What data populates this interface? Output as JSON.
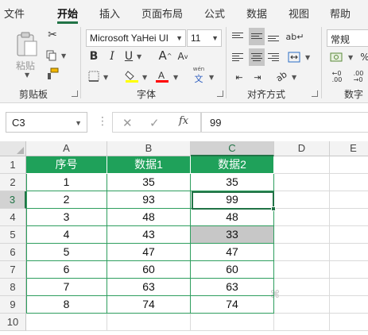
{
  "tabs": [
    "文件",
    "开始",
    "插入",
    "页面布局",
    "公式",
    "数据",
    "视图",
    "帮助"
  ],
  "active_tab": "开始",
  "ribbon": {
    "clipboard": {
      "paste_label": "粘贴",
      "group_label": "剪贴板"
    },
    "font": {
      "font_name": "Microsoft YaHei UI",
      "font_size": "11",
      "group_label": "字体",
      "bold": "B",
      "italic": "I",
      "underline": "U",
      "grow": "A",
      "shrink": "A",
      "phonetic": "文",
      "phonetic_top": "wén",
      "highlight_color": "#ffff00",
      "font_color": "#ff0000"
    },
    "alignment": {
      "group_label": "对齐方式"
    },
    "number": {
      "format": "常规",
      "group_label": "数字"
    }
  },
  "formula_bar": {
    "name_box": "C3",
    "fx": "fx",
    "value": "99",
    "cancel": "✕",
    "enter": "✓"
  },
  "sheet": {
    "columns": [
      "A",
      "B",
      "C",
      "D",
      "E"
    ],
    "active_column": "C",
    "rows": [
      "1",
      "2",
      "3",
      "4",
      "5",
      "6",
      "7",
      "8",
      "9",
      "10"
    ],
    "table_header": [
      "序号",
      "数据1",
      "数据2"
    ],
    "table_rows": [
      [
        "1",
        "35",
        "35"
      ],
      [
        "2",
        "93",
        "99"
      ],
      [
        "3",
        "48",
        "48"
      ],
      [
        "4",
        "43",
        "33"
      ],
      [
        "5",
        "47",
        "47"
      ],
      [
        "6",
        "60",
        "60"
      ],
      [
        "7",
        "63",
        "63"
      ],
      [
        "8",
        "74",
        "74"
      ]
    ],
    "active_cell": "C3",
    "highlighted_cell": "C5",
    "header_fill": "#1fa15a",
    "accent": "#217346"
  }
}
